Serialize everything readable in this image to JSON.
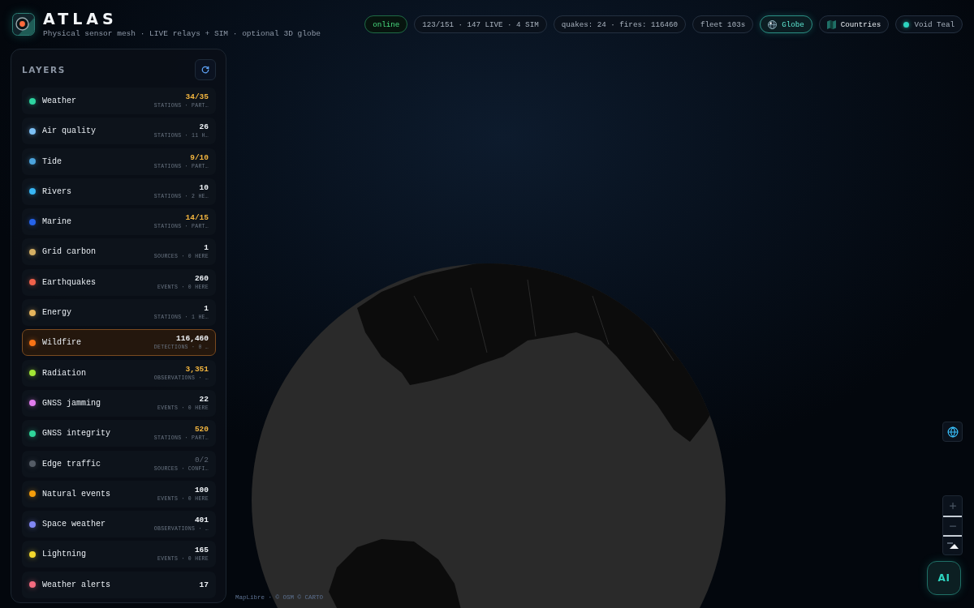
{
  "header": {
    "title": "ATLAS",
    "subtitle": "Physical sensor mesh · LIVE relays + SIM · optional 3D globe"
  },
  "connection": {
    "label": "online",
    "online": true
  },
  "stats": [
    "123/151 · 147 LIVE · 4 SIM",
    "quakes: 24 · fires: 116460",
    "fleet 103s"
  ],
  "view_toggles": [
    {
      "kind": "globe",
      "label": "Globe",
      "selected": true
    },
    {
      "kind": "countries",
      "label": "Countries",
      "selected": false
    }
  ],
  "theme": {
    "label": "Void Teal"
  },
  "layers": {
    "title": "LAYERS",
    "items": [
      {
        "name": "Weather",
        "color": "#2dd4a0",
        "count": "34/35",
        "detail": "STATIONS · PART…",
        "partial": true,
        "disabled": false,
        "selected": false
      },
      {
        "name": "Air quality",
        "color": "#7cc0f5",
        "count": "26",
        "detail": "STATIONS · 11 H…",
        "partial": false,
        "disabled": false,
        "selected": false
      },
      {
        "name": "Tide",
        "color": "#4ba3dc",
        "count": "9/10",
        "detail": "STATIONS · PART…",
        "partial": true,
        "disabled": false,
        "selected": false
      },
      {
        "name": "Rivers",
        "color": "#38b6f5",
        "count": "10",
        "detail": "STATIONS · 2 HE…",
        "partial": false,
        "disabled": false,
        "selected": false
      },
      {
        "name": "Marine",
        "color": "#2563eb",
        "count": "14/15",
        "detail": "STATIONS · PART…",
        "partial": true,
        "disabled": false,
        "selected": false
      },
      {
        "name": "Grid carbon",
        "color": "#d6b064",
        "count": "1",
        "detail": "SOURCES · 0 HERE",
        "partial": false,
        "disabled": false,
        "selected": false
      },
      {
        "name": "Earthquakes",
        "color": "#f0614a",
        "count": "260",
        "detail": "EVENTS · 0 HERE",
        "partial": false,
        "disabled": false,
        "selected": false
      },
      {
        "name": "Energy",
        "color": "#e6b45c",
        "count": "1",
        "detail": "STATIONS · 1 HE…",
        "partial": false,
        "disabled": false,
        "selected": false
      },
      {
        "name": "Wildfire",
        "color": "#f97316",
        "count": "116,460",
        "detail": "DETECTIONS · 0 …",
        "partial": false,
        "disabled": false,
        "selected": true
      },
      {
        "name": "Radiation",
        "color": "#a3e635",
        "count": "3,351",
        "detail": "OBSERVATIONS · …",
        "partial": true,
        "disabled": false,
        "selected": false
      },
      {
        "name": "GNSS jamming",
        "color": "#e27cf0",
        "count": "22",
        "detail": "EVENTS · 0 HERE",
        "partial": false,
        "disabled": false,
        "selected": false
      },
      {
        "name": "GNSS integrity",
        "color": "#2fd69a",
        "count": "520",
        "detail": "STATIONS · PART…",
        "partial": true,
        "disabled": false,
        "selected": false
      },
      {
        "name": "Edge traffic",
        "color": "#555c66",
        "count": "0/2",
        "detail": "SOURCES · CONFI…",
        "partial": false,
        "disabled": true,
        "selected": false
      },
      {
        "name": "Natural events",
        "color": "#f59e0b",
        "count": "100",
        "detail": "EVENTS · 0 HERE",
        "partial": false,
        "disabled": false,
        "selected": false
      },
      {
        "name": "Space weather",
        "color": "#8187f5",
        "count": "401",
        "detail": "OBSERVATIONS · …",
        "partial": false,
        "disabled": false,
        "selected": false
      },
      {
        "name": "Lightning",
        "color": "#f5d92e",
        "count": "165",
        "detail": "EVENTS · 0 HERE",
        "partial": false,
        "disabled": false,
        "selected": false
      },
      {
        "name": "Weather alerts",
        "color": "#f46b7f",
        "count": "17",
        "partial": false,
        "disabled": false,
        "selected": false
      }
    ]
  },
  "assistant_button": {
    "label": "AI"
  },
  "attribution": "MapLibre · © OSM © CARTO"
}
